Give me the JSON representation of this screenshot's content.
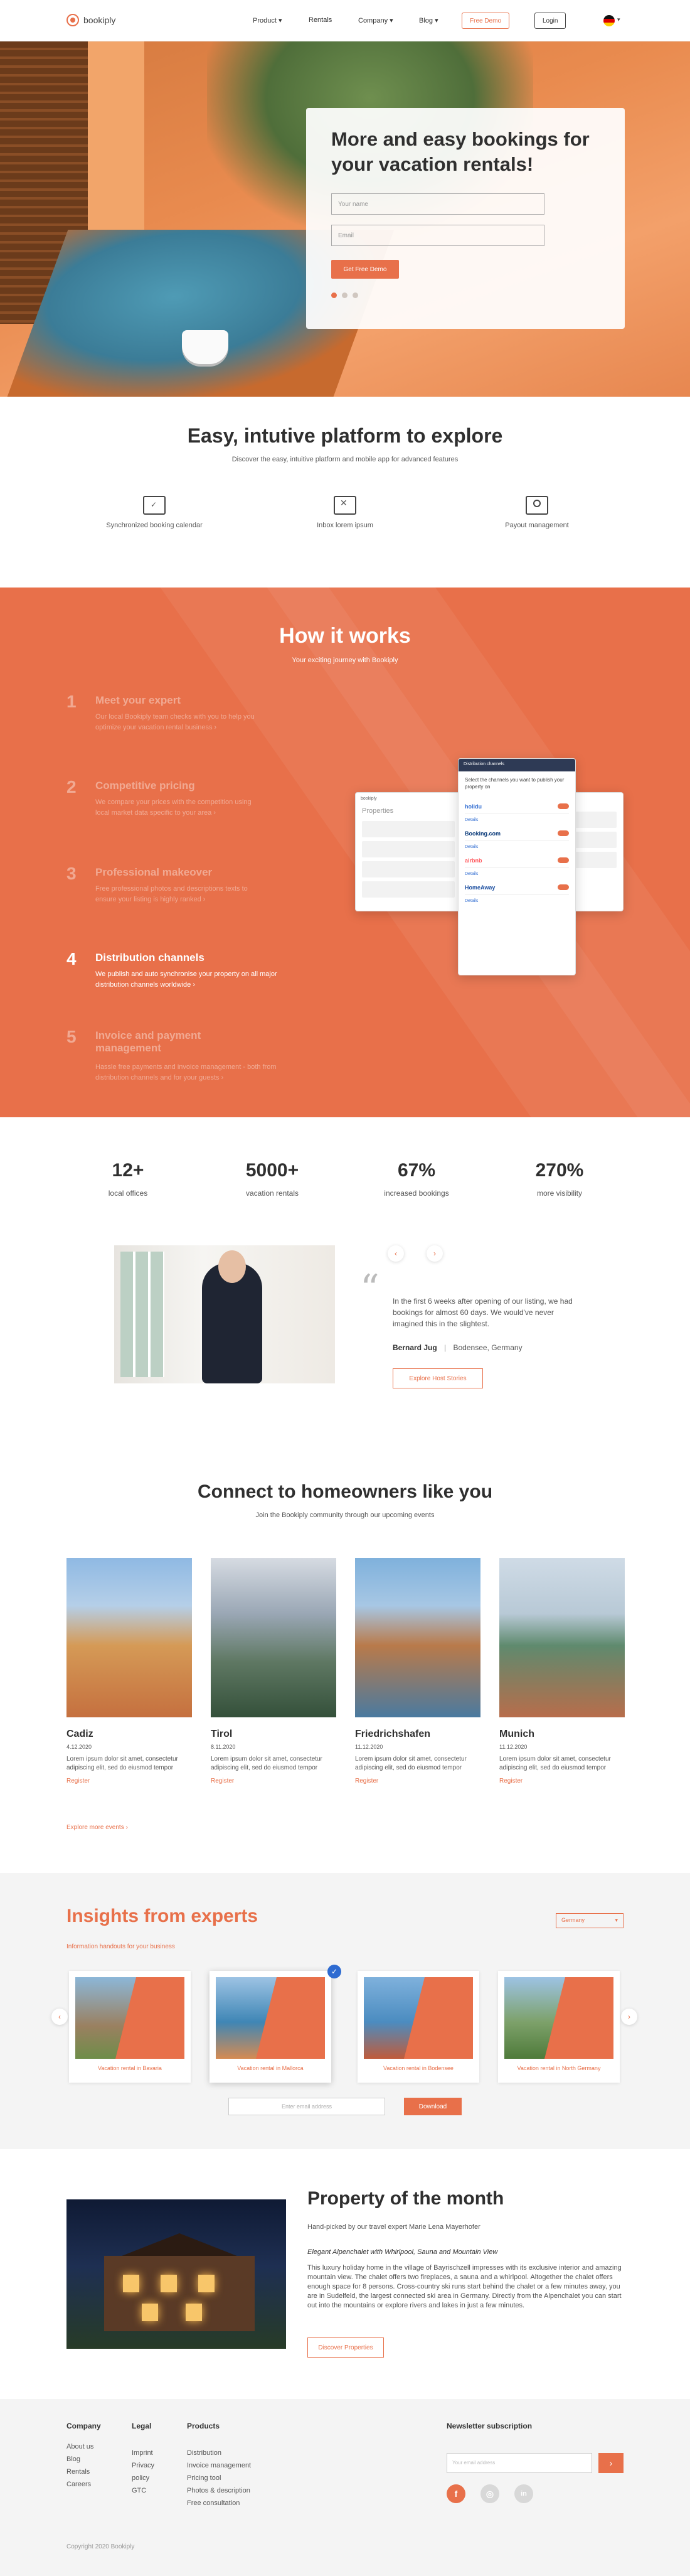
{
  "nav": {
    "logo": "bookiply",
    "items": [
      "Product",
      "Rentals",
      "Company",
      "Blog"
    ],
    "free_demo": "Free Demo",
    "login": "Login"
  },
  "hero": {
    "title": "More and easy bookings for your vacation rentals!",
    "name_placeholder": "Your name",
    "email_placeholder": "Email",
    "cta": "Get Free Demo"
  },
  "platform": {
    "title": "Easy, intutive platform to explore",
    "subtitle": "Discover the easy, intuitive platform and mobile app for advanced features",
    "features": [
      {
        "label": "Synchronized booking calendar",
        "icon": "calendar-icon"
      },
      {
        "label": "Inbox lorem ipsum",
        "icon": "envelope-icon"
      },
      {
        "label": "Payout management",
        "icon": "payout-icon"
      }
    ]
  },
  "how": {
    "title": "How it works",
    "subtitle": "Your exciting journey with Bookiply",
    "steps": [
      {
        "num": "1",
        "title": "Meet your expert",
        "text": "Our local Bookiply team checks with you to help you optimize your vacation rental business ›"
      },
      {
        "num": "2",
        "title": "Competitive pricing",
        "text": "We compare your prices with the competition using local market data specific to your area ›"
      },
      {
        "num": "3",
        "title": "Professional makeover",
        "text": "Free professional photos and descriptions texts to ensure your listing is highly ranked ›"
      },
      {
        "num": "4",
        "title": "Distribution channels",
        "text": "We publish and auto synchronise your property on all major distribution channels worldwide ›"
      },
      {
        "num": "5",
        "title": "Invoice and payment management",
        "text": "Hassle free payments and invoice management - both from distribution channels and for your guests ›"
      }
    ],
    "app": {
      "properties_label": "Properties",
      "channels_header": "Distribution channels",
      "channels_intro": "Select the channels you want to publish your property on",
      "channels": [
        "holidu",
        "Booking.com",
        "airbnb",
        "HomeAway"
      ],
      "details": "Details"
    }
  },
  "stats": [
    {
      "num": "12+",
      "label": "local offices"
    },
    {
      "num": "5000+",
      "label": "vacation rentals"
    },
    {
      "num": "67%",
      "label": "increased bookings"
    },
    {
      "num": "270%",
      "label": "more visibility"
    }
  ],
  "testimonial": {
    "quote": "In the first 6 weeks after opening of our listing, we had bookings for almost 60 days. We would've never imagined this in the slightest.",
    "author": "Bernard Jug",
    "location": "Bodensee, Germany",
    "cta": "Explore Host Stories"
  },
  "events": {
    "title": "Connect to homeowners like you",
    "subtitle": "Join the Bookiply community through our upcoming events",
    "items": [
      {
        "name": "Cadiz",
        "date": "4.12.2020",
        "desc": "Lorem ipsum dolor sit amet, consectetur adipiscing elit, sed do eiusmod tempor",
        "register": "Register"
      },
      {
        "name": "Tirol",
        "date": "8.11.2020",
        "desc": "Lorem ipsum dolor sit amet, consectetur adipiscing elit, sed do eiusmod tempor",
        "register": "Register"
      },
      {
        "name": "Friedrichshafen",
        "date": "11.12.2020",
        "desc": "Lorem ipsum dolor sit amet, consectetur adipiscing elit, sed do eiusmod tempor",
        "register": "Register"
      },
      {
        "name": "Munich",
        "date": "11.12.2020",
        "desc": "Lorem ipsum dolor sit amet, consectetur adipiscing elit, sed do eiusmod tempor",
        "register": "Register"
      }
    ],
    "more": "Explore more events ›"
  },
  "insights": {
    "title": "Insights from experts",
    "subtitle": "Information handouts for your business",
    "country": "Germany",
    "cards": [
      "Vacation rental in Bavaria",
      "Vacation rental in Mallorca",
      "Vacation rental in Bodensee",
      "Vacation rental in North Germany"
    ],
    "email_placeholder": "Enter email address",
    "download": "Download"
  },
  "property": {
    "title": "Property of the month",
    "intro": "Hand-picked by our travel expert Marie Lena Mayerhofer",
    "tagline": "Elegant Alpenchalet with Whirlpool, Sauna and Mountain View",
    "text": "This luxury holiday home in the village of Bayrischzell impresses with its exclusive interior and amazing mountain view. The chalet offers two fireplaces, a sauna and a whirlpool. Altogether the chalet offers enough space for 8 persons. Cross-country ski runs start behind the chalet or a few minutes away, you are in Sudelfeld, the largest connected ski area in Germany. Directly from the Alpenchalet you can start out into the mountains or explore rivers and lakes in just a few minutes.",
    "cta": "Discover Properties"
  },
  "footer": {
    "company": {
      "head": "Company",
      "links": [
        "About us",
        "Blog",
        "Rentals",
        "Careers"
      ]
    },
    "legal": {
      "head": "Legal",
      "links": [
        "Imprint",
        "Privacy policy",
        "GTC"
      ]
    },
    "products": {
      "head": "Products",
      "links": [
        "Distribution",
        "Invoice management",
        "Pricing tool",
        "Photos & description",
        "Free consultation"
      ]
    },
    "newsletter": {
      "head": "Newsletter subscription",
      "placeholder": "Your email address"
    },
    "copyright": "Copyright 2020 Bookiply"
  },
  "colors": {
    "accent": "#e8704a",
    "dark": "#2f2f2f",
    "footer_bg": "#f4f4f4"
  }
}
